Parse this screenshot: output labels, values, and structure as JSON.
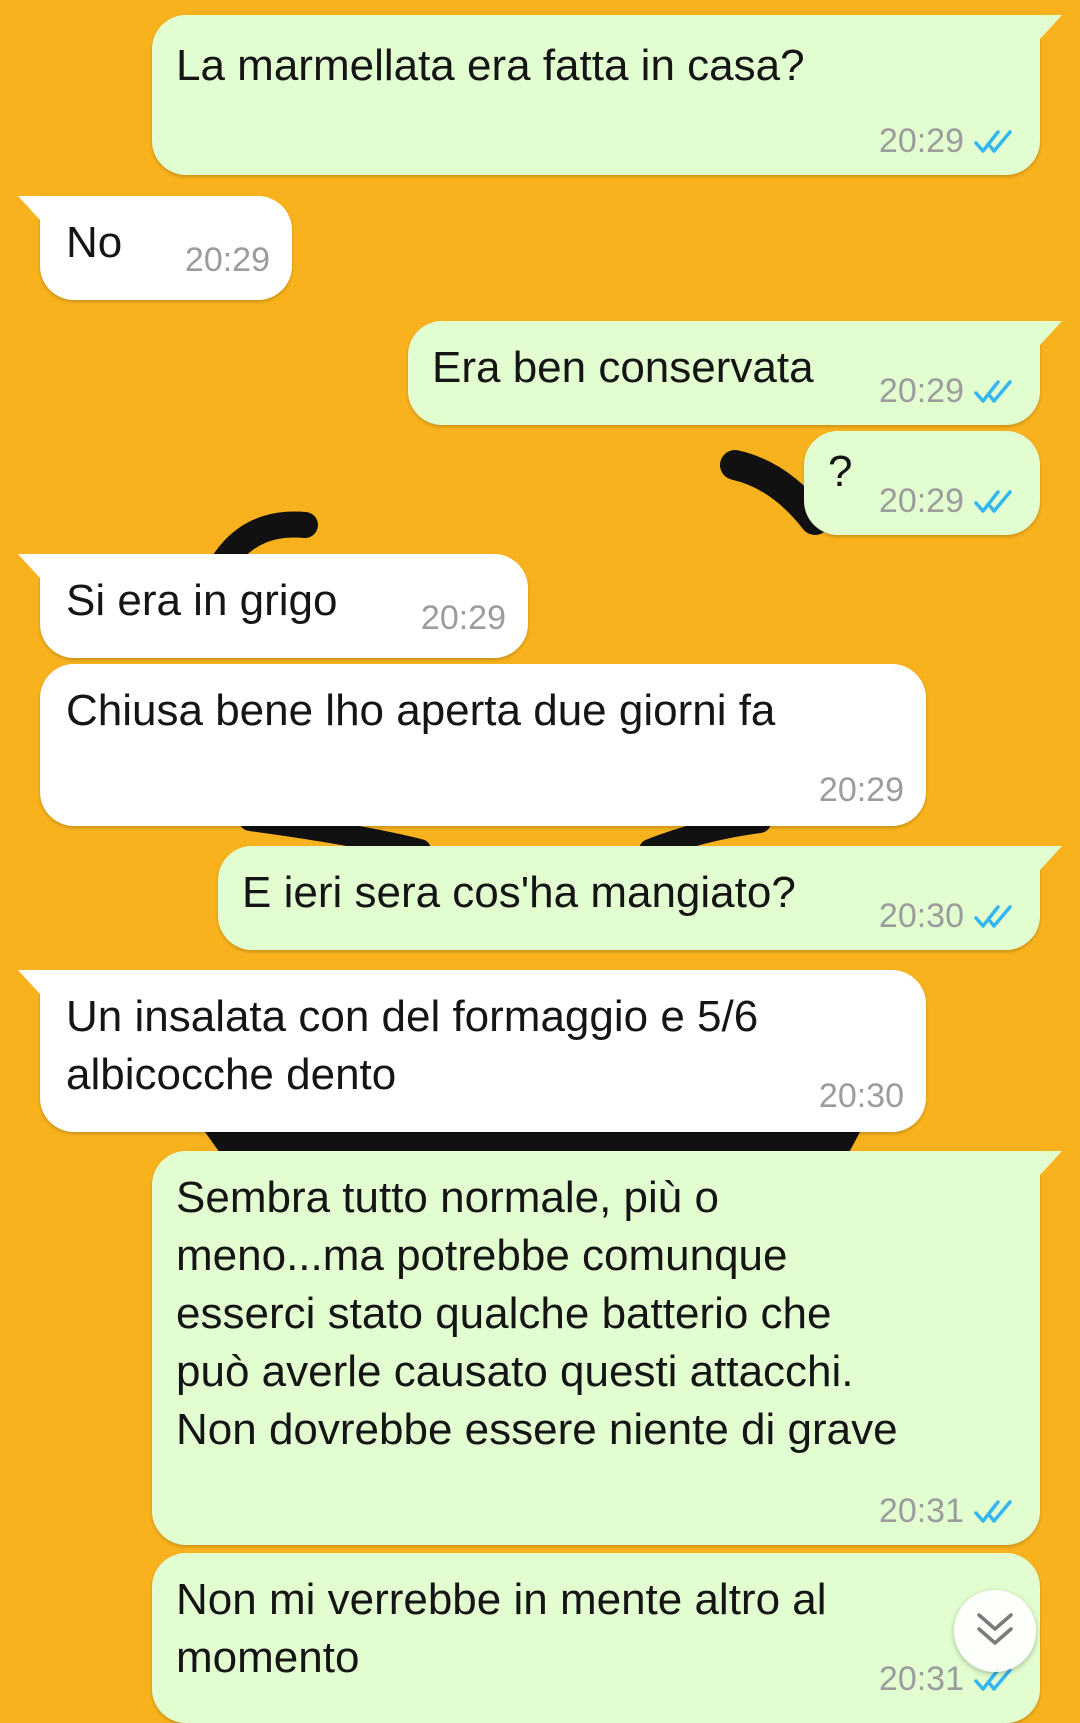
{
  "colors": {
    "wallpaper": "#f7b21d",
    "outgoing_bubble": "#e2fdd0",
    "incoming_bubble": "#ffffff",
    "timestamp": "#9c9c9c",
    "read_receipt": "#34b7f1"
  },
  "icons": {
    "read_receipt": "double-check-icon",
    "scroll_down": "chevron-double-down-icon"
  },
  "messages": [
    {
      "direction": "outgoing",
      "text": "La marmellata era fatta in casa?",
      "time": "20:29",
      "status": "read"
    },
    {
      "direction": "incoming",
      "text": "No",
      "time": "20:29"
    },
    {
      "direction": "outgoing",
      "text": "Era ben conservata",
      "time": "20:29",
      "status": "read"
    },
    {
      "direction": "outgoing",
      "text": "?",
      "time": "20:29",
      "status": "read"
    },
    {
      "direction": "incoming",
      "text": "Si era in grigo",
      "time": "20:29"
    },
    {
      "direction": "incoming",
      "text": "Chiusa bene lho aperta due giorni fa",
      "time": "20:29"
    },
    {
      "direction": "outgoing",
      "text": "E ieri sera cos'ha mangiato?",
      "time": "20:30",
      "status": "read"
    },
    {
      "direction": "incoming",
      "lines": [
        "Un insalata con del formaggio e 5/6",
        "albicocche dento"
      ],
      "time": "20:30"
    },
    {
      "direction": "outgoing",
      "lines": [
        "Sembra tutto normale, più o",
        "meno...ma potrebbe comunque",
        "esserci stato qualche batterio che",
        "può averle causato questi attacchi.",
        "Non dovrebbe essere niente di grave"
      ],
      "time": "20:31",
      "status": "read"
    },
    {
      "direction": "outgoing",
      "lines": [
        "Non mi verrebbe in mente altro al",
        "momento"
      ],
      "time": "20:31",
      "status": "read"
    }
  ]
}
